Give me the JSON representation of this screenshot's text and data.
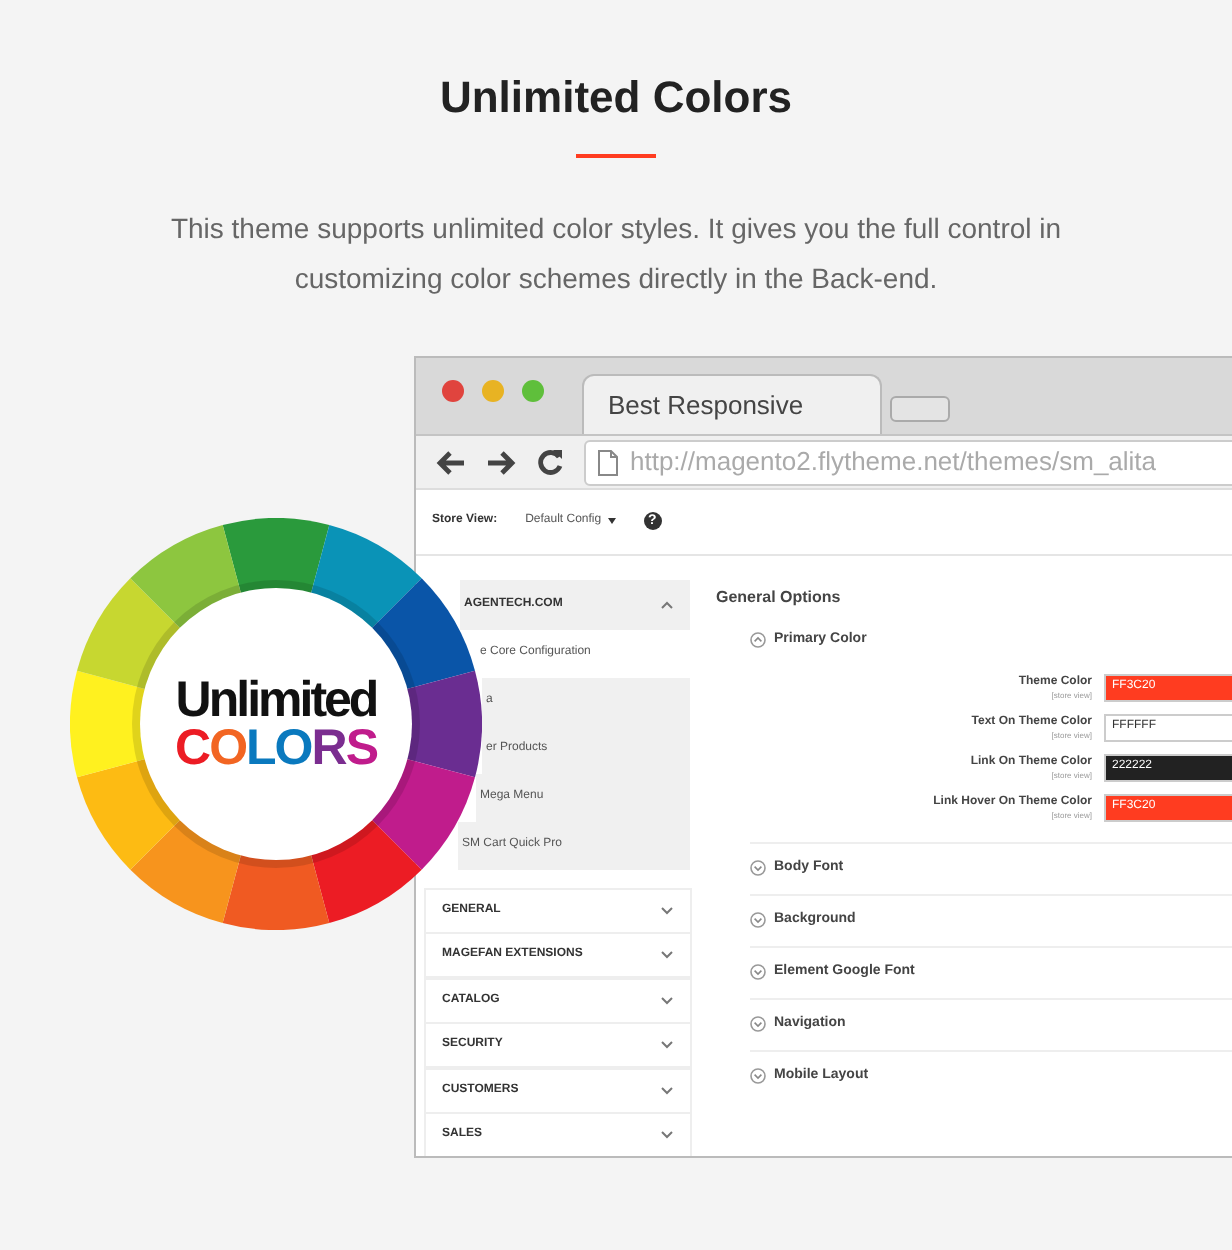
{
  "heading": {
    "title": "Unlimited Colors",
    "text": "This theme supports unlimited color styles. It gives you the full control in customizing color schemes directly in the Back-end."
  },
  "badge": {
    "line1": "Unlimited",
    "line2": "COLORS"
  },
  "browser": {
    "tab": "Best Responsive",
    "url": "http://magento2.flytheme.net/themes/sm_alita"
  },
  "store_view": {
    "label": "Store View:",
    "value": "Default Config",
    "help": "?"
  },
  "sidebar": {
    "group": {
      "label": "AGENTECH.COM",
      "expanded": true,
      "items": [
        {
          "label": "e Core Configuration",
          "selected": true
        },
        {
          "label": "a",
          "selected": false
        },
        {
          "label": "er Products",
          "selected": false
        },
        {
          "label": "Mega Menu",
          "selected": false
        },
        {
          "label": "SM Cart Quick Pro",
          "selected": false
        }
      ]
    },
    "sections": [
      {
        "label": "GENERAL",
        "expanded": false
      },
      {
        "label": "MAGEFAN EXTENSIONS",
        "expanded": false
      },
      {
        "label": "CATALOG",
        "expanded": false
      },
      {
        "label": "SECURITY",
        "expanded": false
      },
      {
        "label": "CUSTOMERS",
        "expanded": false
      },
      {
        "label": "SALES",
        "expanded": false
      }
    ]
  },
  "main": {
    "title": "General Options",
    "groups": [
      {
        "label": "Primary Color",
        "expanded": true,
        "fields": [
          {
            "label": "Theme Color",
            "scope": "[store view]",
            "value": "FF3C20",
            "color": "#ff3c20"
          },
          {
            "label": "Text On Theme Color",
            "scope": "[store view]",
            "value": "FFFFFF",
            "color": "#ffffff"
          },
          {
            "label": "Link On Theme Color",
            "scope": "[store view]",
            "value": "222222",
            "color": "#222222"
          },
          {
            "label": "Link Hover On Theme Color",
            "scope": "[store view]",
            "value": "FF3C20",
            "color": "#ff3c20"
          }
        ]
      },
      {
        "label": "Body Font",
        "expanded": false
      },
      {
        "label": "Background",
        "expanded": false
      },
      {
        "label": "Element Google Font",
        "expanded": false
      },
      {
        "label": "Navigation",
        "expanded": false
      },
      {
        "label": "Mobile Layout",
        "expanded": false
      }
    ]
  }
}
